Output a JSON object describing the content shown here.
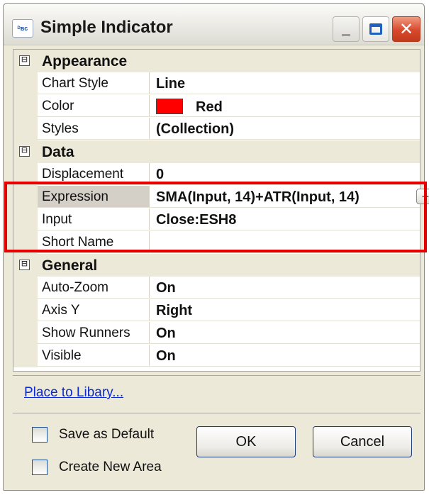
{
  "window": {
    "title": "Simple Indicator",
    "icon_text": "ᴰʙᴄ",
    "icon": "indicator-app-icon",
    "controls": [
      "minimize-icon",
      "maximize-icon",
      "close-icon"
    ]
  },
  "property_grid": {
    "categories": [
      {
        "label": "Appearance",
        "toggle": "⊟",
        "properties": [
          {
            "name": "Chart Style",
            "value": "Line"
          },
          {
            "name": "Color",
            "value": "Red",
            "swatch_color": "#ff0000"
          },
          {
            "name": "Styles",
            "value": "(Collection)"
          }
        ]
      },
      {
        "label": "Data",
        "toggle": "⊟",
        "properties": [
          {
            "name": "Displacement",
            "value": "0"
          },
          {
            "name": "Expression",
            "value": "SMA(Input, 14)+ATR(Input, 14)",
            "button": "..."
          },
          {
            "name": "Input",
            "value": "Close:ESH8"
          },
          {
            "name": "Short Name",
            "value": ""
          }
        ]
      },
      {
        "label": "General",
        "toggle": "⊟",
        "properties": [
          {
            "name": "Auto-Zoom",
            "value": "On"
          },
          {
            "name": "Axis Y",
            "value": "Right"
          },
          {
            "name": "Show Runners",
            "value": "On"
          },
          {
            "name": "Visible",
            "value": "On"
          }
        ]
      }
    ],
    "highlight_color": "#e60000"
  },
  "link": {
    "label": "Place to Libary..."
  },
  "options": {
    "save_default": "Save as Default",
    "create_area": "Create New Area"
  },
  "buttons": {
    "ok": "OK",
    "cancel": "Cancel"
  }
}
